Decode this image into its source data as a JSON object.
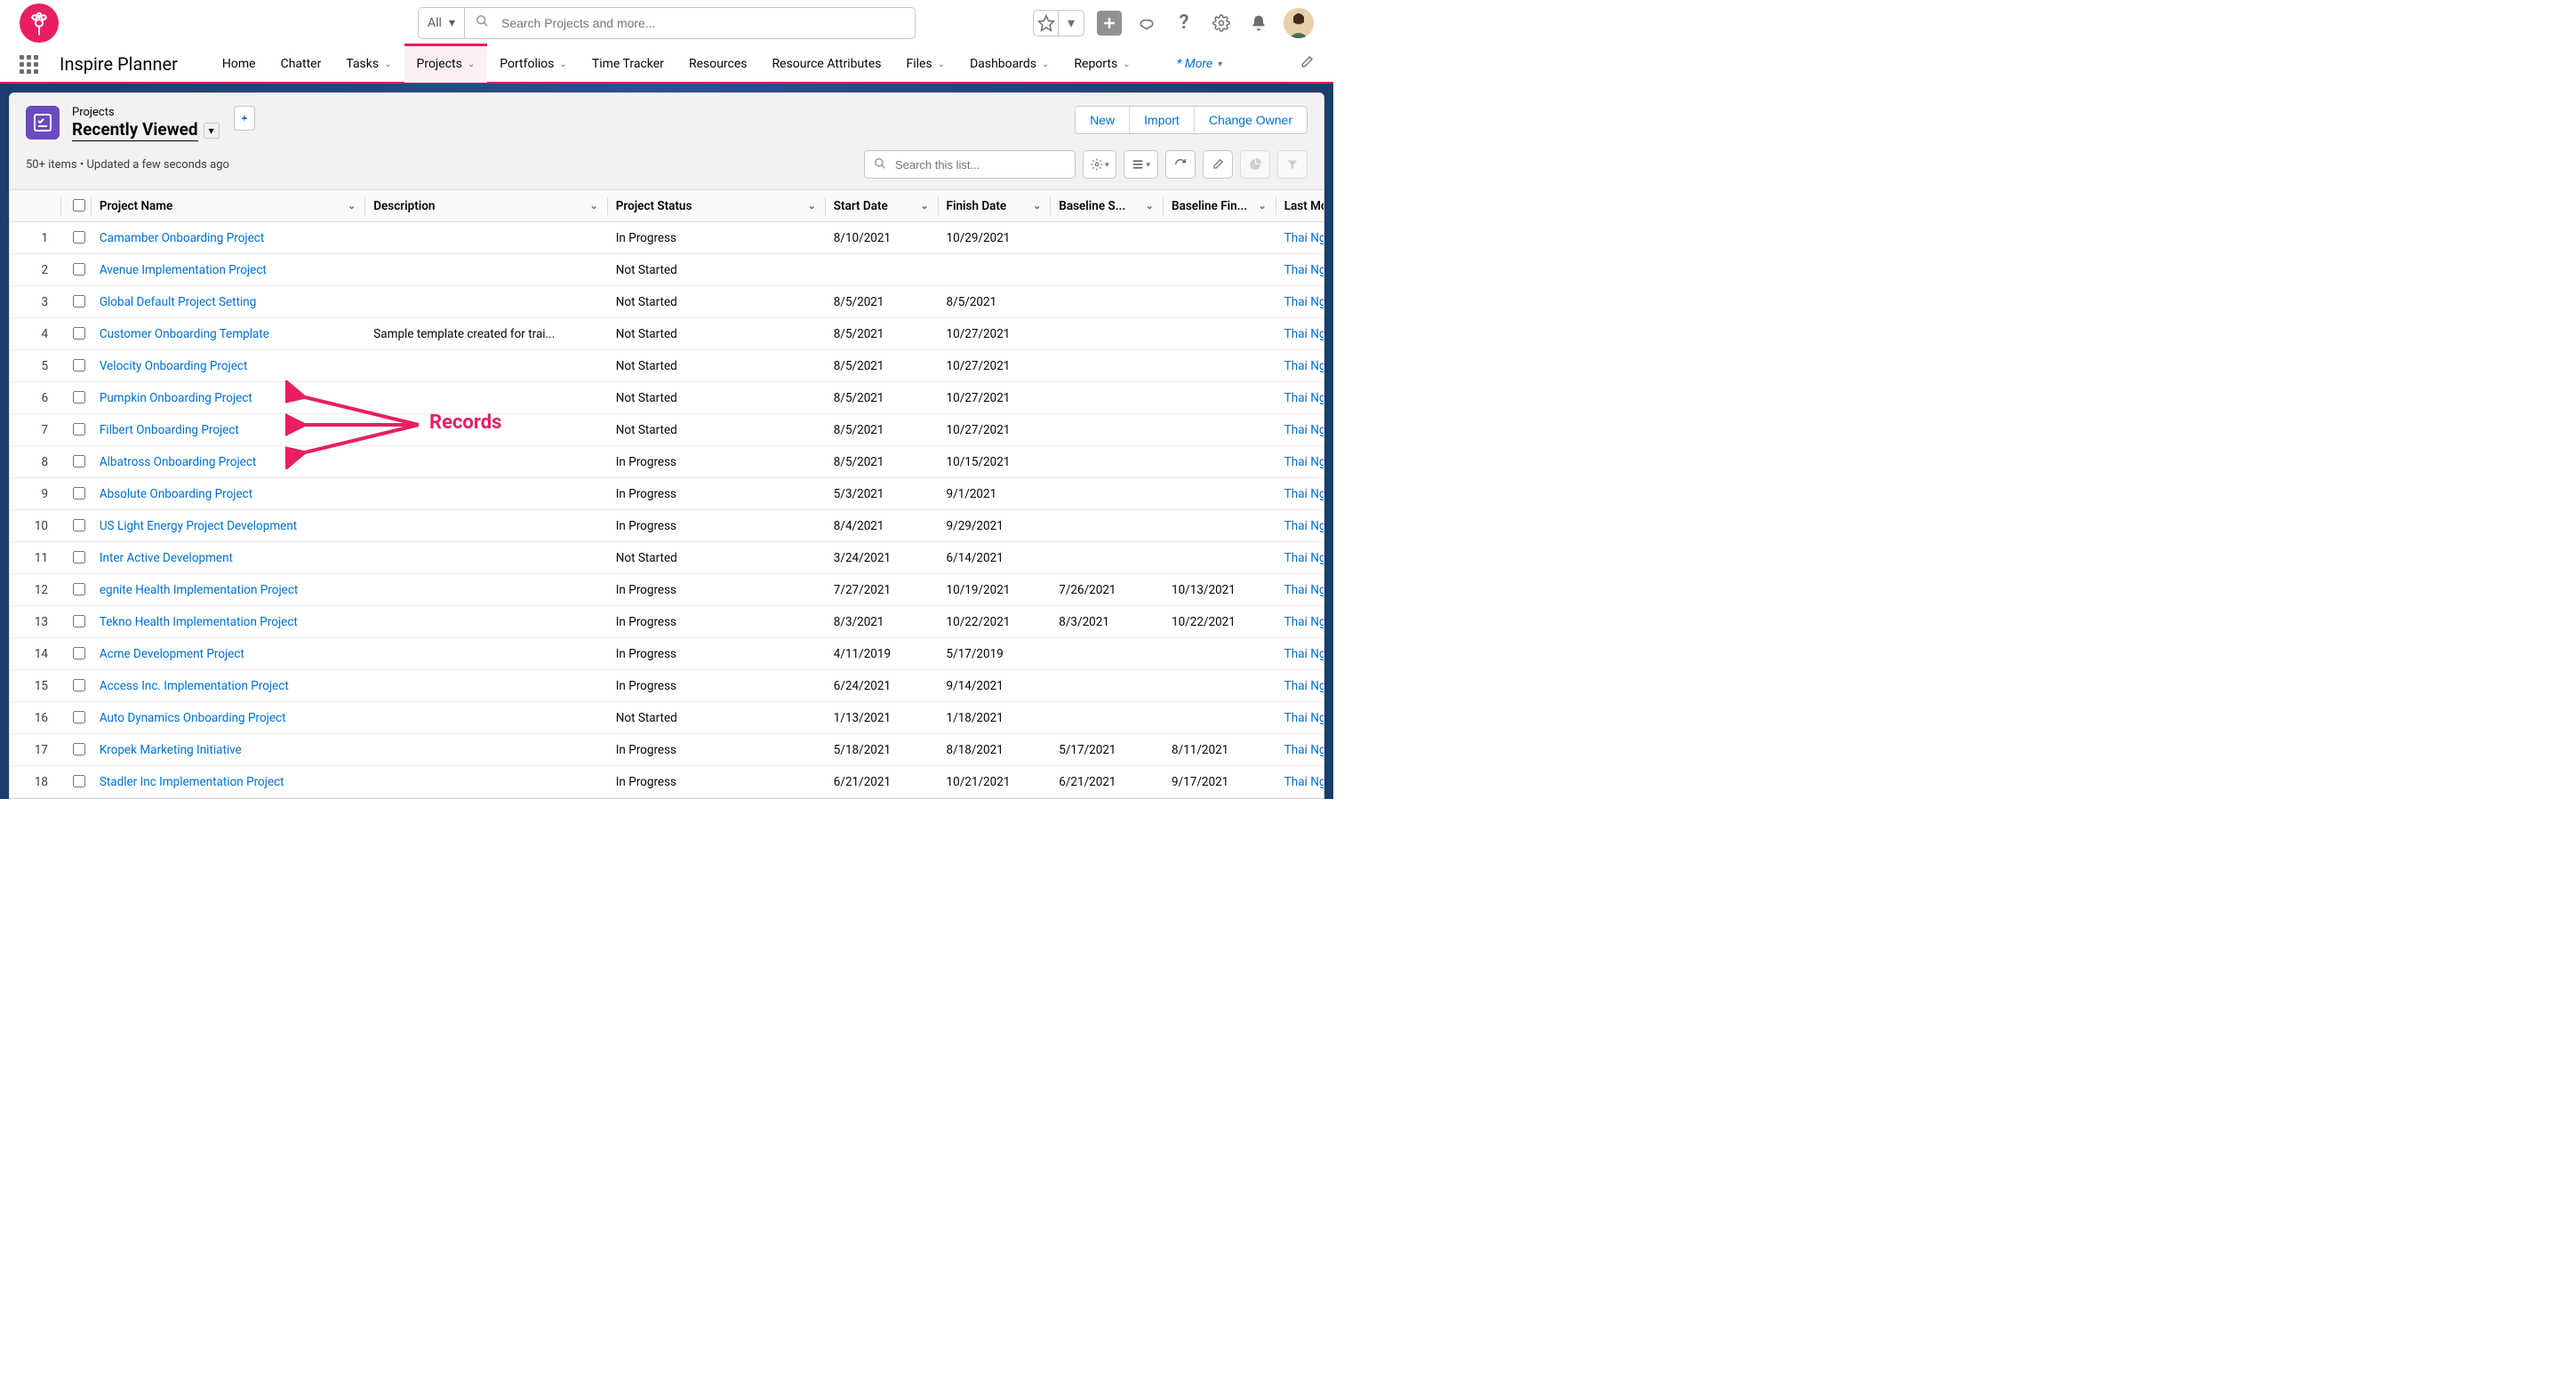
{
  "global_search": {
    "scope": "All",
    "placeholder": "Search Projects and more..."
  },
  "app_name": "Inspire Planner",
  "nav": [
    {
      "label": "Home",
      "caret": false
    },
    {
      "label": "Chatter",
      "caret": false
    },
    {
      "label": "Tasks",
      "caret": true
    },
    {
      "label": "Projects",
      "caret": true,
      "active": true
    },
    {
      "label": "Portfolios",
      "caret": true
    },
    {
      "label": "Time Tracker",
      "caret": false
    },
    {
      "label": "Resources",
      "caret": false
    },
    {
      "label": "Resource Attributes",
      "caret": false
    },
    {
      "label": "Files",
      "caret": true
    },
    {
      "label": "Dashboards",
      "caret": true
    },
    {
      "label": "Reports",
      "caret": true
    }
  ],
  "nav_more": "* More",
  "object_label": "Projects",
  "list_view": "Recently Viewed",
  "meta": "50+ items • Updated a few seconds ago",
  "actions": {
    "new": "New",
    "import": "Import",
    "change_owner": "Change Owner"
  },
  "list_search_placeholder": "Search this list...",
  "columns": [
    "Project Name",
    "Description",
    "Project Status",
    "Start Date",
    "Finish Date",
    "Baseline S...",
    "Baseline Fin...",
    "Last Modifie"
  ],
  "annotation_label": "Records",
  "rows": [
    {
      "n": 1,
      "name": "Camamber Onboarding Project",
      "desc": "",
      "status": "In Progress",
      "start": "8/10/2021",
      "finish": "10/29/2021",
      "bs": "",
      "bf": "",
      "mod": "Thai Nguyen"
    },
    {
      "n": 2,
      "name": "Avenue Implementation Project",
      "desc": "",
      "status": "Not Started",
      "start": "",
      "finish": "",
      "bs": "",
      "bf": "",
      "mod": "Thai Nguyen"
    },
    {
      "n": 3,
      "name": "Global Default Project Setting",
      "desc": "",
      "status": "Not Started",
      "start": "8/5/2021",
      "finish": "8/5/2021",
      "bs": "",
      "bf": "",
      "mod": "Thai Nguyen"
    },
    {
      "n": 4,
      "name": "Customer Onboarding Template",
      "desc": "Sample template created for trai...",
      "status": "Not Started",
      "start": "8/5/2021",
      "finish": "10/27/2021",
      "bs": "",
      "bf": "",
      "mod": "Thai Nguyen"
    },
    {
      "n": 5,
      "name": "Velocity Onboarding Project",
      "desc": "",
      "status": "Not Started",
      "start": "8/5/2021",
      "finish": "10/27/2021",
      "bs": "",
      "bf": "",
      "mod": "Thai Nguyen"
    },
    {
      "n": 6,
      "name": "Pumpkin Onboarding Project",
      "desc": "",
      "status": "Not Started",
      "start": "8/5/2021",
      "finish": "10/27/2021",
      "bs": "",
      "bf": "",
      "mod": "Thai Nguyen"
    },
    {
      "n": 7,
      "name": "Filbert Onboarding Project",
      "desc": "",
      "status": "Not Started",
      "start": "8/5/2021",
      "finish": "10/27/2021",
      "bs": "",
      "bf": "",
      "mod": "Thai Nguyen"
    },
    {
      "n": 8,
      "name": "Albatross Onboarding Project",
      "desc": "",
      "status": "In Progress",
      "start": "8/5/2021",
      "finish": "10/15/2021",
      "bs": "",
      "bf": "",
      "mod": "Thai Nguyen"
    },
    {
      "n": 9,
      "name": "Absolute Onboarding Project",
      "desc": "",
      "status": "In Progress",
      "start": "5/3/2021",
      "finish": "9/1/2021",
      "bs": "",
      "bf": "",
      "mod": "Thai Nguyen"
    },
    {
      "n": 10,
      "name": "US Light Energy Project Development",
      "desc": "",
      "status": "In Progress",
      "start": "8/4/2021",
      "finish": "9/29/2021",
      "bs": "",
      "bf": "",
      "mod": "Thai Nguyen"
    },
    {
      "n": 11,
      "name": "Inter Active Development",
      "desc": "",
      "status": "Not Started",
      "start": "3/24/2021",
      "finish": "6/14/2021",
      "bs": "",
      "bf": "",
      "mod": "Thai Nguyen"
    },
    {
      "n": 12,
      "name": "egnite Health Implementation Project",
      "desc": "",
      "status": "In Progress",
      "start": "7/27/2021",
      "finish": "10/19/2021",
      "bs": "7/26/2021",
      "bf": "10/13/2021",
      "mod": "Thai Nguyen"
    },
    {
      "n": 13,
      "name": "Tekno Health Implementation Project",
      "desc": "",
      "status": "In Progress",
      "start": "8/3/2021",
      "finish": "10/22/2021",
      "bs": "8/3/2021",
      "bf": "10/22/2021",
      "mod": "Thai Nguyen"
    },
    {
      "n": 14,
      "name": "Acme Development Project",
      "desc": "",
      "status": "In Progress",
      "start": "4/11/2019",
      "finish": "5/17/2019",
      "bs": "",
      "bf": "",
      "mod": "Thai Nguyen"
    },
    {
      "n": 15,
      "name": "Access Inc. Implementation Project",
      "desc": "",
      "status": "In Progress",
      "start": "6/24/2021",
      "finish": "9/14/2021",
      "bs": "",
      "bf": "",
      "mod": "Thai Nguyen"
    },
    {
      "n": 16,
      "name": "Auto Dynamics Onboarding Project",
      "desc": "",
      "status": "Not Started",
      "start": "1/13/2021",
      "finish": "1/18/2021",
      "bs": "",
      "bf": "",
      "mod": "Thai Nguyen"
    },
    {
      "n": 17,
      "name": "Kropek Marketing Initiative",
      "desc": "",
      "status": "In Progress",
      "start": "5/18/2021",
      "finish": "8/18/2021",
      "bs": "5/17/2021",
      "bf": "8/11/2021",
      "mod": "Thai Nguyen"
    },
    {
      "n": 18,
      "name": "Stadler Inc Implementation Project",
      "desc": "",
      "status": "In Progress",
      "start": "6/21/2021",
      "finish": "10/21/2021",
      "bs": "6/21/2021",
      "bf": "9/17/2021",
      "mod": "Thai Nguyen"
    }
  ]
}
